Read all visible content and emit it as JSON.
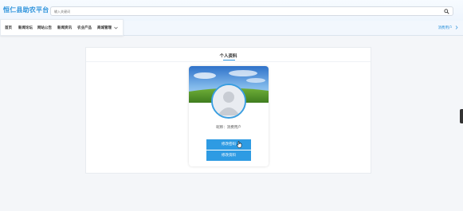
{
  "app": {
    "logo": "恒仁县助农平台",
    "search_placeholder": "输入关键词"
  },
  "nav": {
    "items": [
      "首页",
      "新闻论坛",
      "网站公告",
      "新闻资讯",
      "农业产品",
      "商城管理"
    ],
    "right_label": "消费用户"
  },
  "profile": {
    "title": "个人资料",
    "nickname_label": "昵称：",
    "nickname_value": "消费用户",
    "buttons": [
      "修改密码",
      "修改资料"
    ]
  },
  "colors": {
    "brand": "#2e93db",
    "button": "#2e9be3"
  },
  "icons": [
    "search-icon",
    "chevron-down-icon",
    "user-avatar-icon",
    "mouse-cursor-icon"
  ]
}
